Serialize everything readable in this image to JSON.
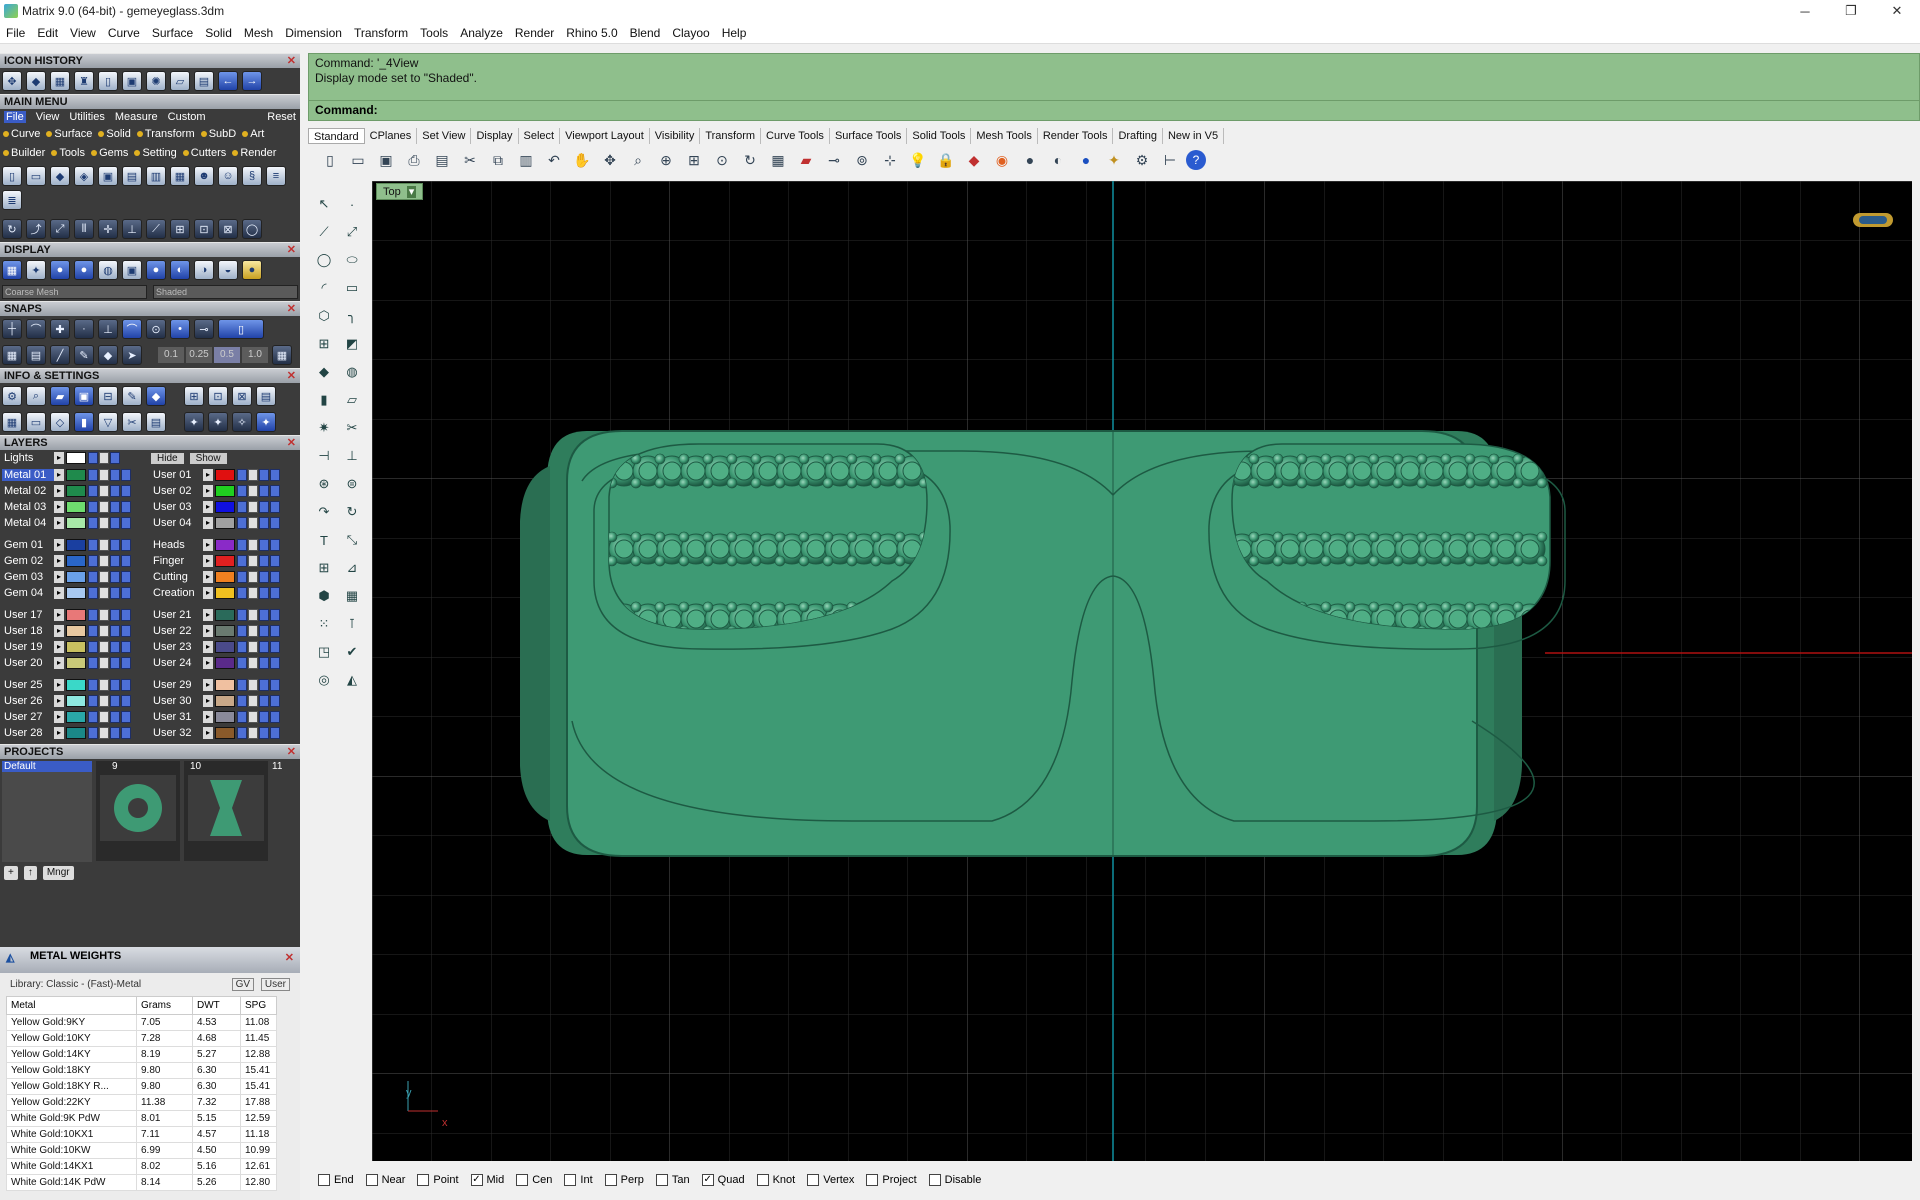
{
  "window": {
    "title": "Matrix 9.0 (64-bit) - gemeyeglass.3dm",
    "min": "─",
    "restore": "❐",
    "close": "✕"
  },
  "menu": [
    "File",
    "Edit",
    "View",
    "Curve",
    "Surface",
    "Solid",
    "Mesh",
    "Dimension",
    "Transform",
    "Tools",
    "Analyze",
    "Render",
    "Rhino 5.0",
    "Blend",
    "Clayoo",
    "Help"
  ],
  "panels": {
    "icon_history": "ICON HISTORY",
    "main_menu": "MAIN MENU",
    "display": "DISPLAY",
    "snaps": "SNAPS",
    "info": "INFO & SETTINGS",
    "layers": "LAYERS",
    "projects": "PROJECTS",
    "close": "✕"
  },
  "main_menu": {
    "tabs": [
      "File",
      "View",
      "Utilities",
      "Measure",
      "Custom",
      "Reset"
    ],
    "row1": [
      "Curve",
      "Surface",
      "Solid",
      "Transform",
      "SubD",
      "Art"
    ],
    "row2": [
      "Builder",
      "Tools",
      "Gems",
      "Setting",
      "Cutters",
      "Render"
    ]
  },
  "display": {
    "mesh_option": "Coarse Mesh",
    "mode": "Shaded"
  },
  "snaps": {
    "values": [
      "0.1",
      "0.25",
      "0.5",
      "1.0"
    ]
  },
  "layers": {
    "lights": "Lights",
    "hide": "Hide",
    "show": "Show",
    "left": [
      "Metal 01",
      "Metal 02",
      "Metal 03",
      "Metal 04",
      "Gem 01",
      "Gem 02",
      "Gem 03",
      "Gem 04",
      "User 17",
      "User 18",
      "User 19",
      "User 20",
      "User 25",
      "User 26",
      "User 27",
      "User 28"
    ],
    "left_colors": [
      "#1f8a4c",
      "#1f8a4c",
      "#6edc6e",
      "#a8e8a8",
      "#1a3fa0",
      "#2a66c8",
      "#6aa0e8",
      "#a8c8f0",
      "#e87878",
      "#e8c8a0",
      "#c8c060",
      "#c8c878",
      "#3ad8c8",
      "#8ee8e0",
      "#2aa8a8",
      "#1a8888"
    ],
    "right": [
      "User 01",
      "User 02",
      "User 03",
      "User 04",
      "Heads",
      "Finger",
      "Cutting",
      "Creation",
      "User 21",
      "User 22",
      "User 23",
      "User 24",
      "User 29",
      "User 30",
      "User 31",
      "User 32"
    ],
    "right_colors": [
      "#e01010",
      "#20d020",
      "#1010e0",
      "#a0a0a0",
      "#8a2ac8",
      "#e02020",
      "#f08020",
      "#f0c020",
      "#2a6a5a",
      "#6a7a70",
      "#4a4a8a",
      "#5a2a8a",
      "#f0c0a0",
      "#c8a888",
      "#8a8a9a",
      "#8a5a2a"
    ]
  },
  "projects": {
    "default": "Default",
    "thumbs": [
      "9",
      "10",
      "11"
    ],
    "buttons": [
      "+",
      "↑",
      "Mngr"
    ]
  },
  "metal_weights": {
    "title": "METAL WEIGHTS",
    "library": "Library: Classic - (Fast)-Metal",
    "gv": "GV",
    "user": "User",
    "columns": [
      "Metal",
      "Grams",
      "DWT",
      "SPG"
    ],
    "rows": [
      [
        "Yellow Gold:9KY",
        "7.05",
        "4.53",
        "11.08"
      ],
      [
        "Yellow Gold:10KY",
        "7.28",
        "4.68",
        "11.45"
      ],
      [
        "Yellow Gold:14KY",
        "8.19",
        "5.27",
        "12.88"
      ],
      [
        "Yellow Gold:18KY",
        "9.80",
        "6.30",
        "15.41"
      ],
      [
        "Yellow Gold:18KY R...",
        "9.80",
        "6.30",
        "15.41"
      ],
      [
        "Yellow Gold:22KY",
        "11.38",
        "7.32",
        "17.88"
      ],
      [
        "White Gold:9K PdW",
        "8.01",
        "5.15",
        "12.59"
      ],
      [
        "White Gold:10KX1",
        "7.11",
        "4.57",
        "11.18"
      ],
      [
        "White Gold:10KW",
        "6.99",
        "4.50",
        "10.99"
      ],
      [
        "White Gold:14KX1",
        "8.02",
        "5.16",
        "12.61"
      ],
      [
        "White Gold:14K PdW",
        "8.14",
        "5.26",
        "12.80"
      ]
    ]
  },
  "command": {
    "history": [
      "Command: '_4View",
      "Display mode set to \"Shaded\"."
    ],
    "prompt": "Command:"
  },
  "tabs": [
    "Standard",
    "CPlanes",
    "Set View",
    "Display",
    "Select",
    "Viewport Layout",
    "Visibility",
    "Transform",
    "Curve Tools",
    "Surface Tools",
    "Solid Tools",
    "Mesh Tools",
    "Render Tools",
    "Drafting",
    "New in V5"
  ],
  "viewport": {
    "name": "Top",
    "axis_y": "y",
    "axis_x": "x"
  },
  "osnaps": [
    {
      "label": "End",
      "checked": false
    },
    {
      "label": "Near",
      "checked": false
    },
    {
      "label": "Point",
      "checked": false
    },
    {
      "label": "Mid",
      "checked": true
    },
    {
      "label": "Cen",
      "checked": false
    },
    {
      "label": "Int",
      "checked": false
    },
    {
      "label": "Perp",
      "checked": false
    },
    {
      "label": "Tan",
      "checked": false
    },
    {
      "label": "Quad",
      "checked": true
    },
    {
      "label": "Knot",
      "checked": false
    },
    {
      "label": "Vertex",
      "checked": false
    },
    {
      "label": "Project",
      "checked": false
    },
    {
      "label": "Disable",
      "checked": false
    }
  ],
  "colors": {
    "viewport_bg": "#000000",
    "model": "#3e9a74",
    "command_bg": "#8fbf8c",
    "accent": "#3a5cc6"
  }
}
